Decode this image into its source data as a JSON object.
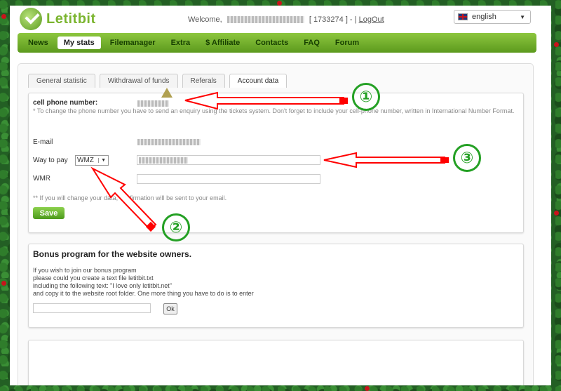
{
  "header": {
    "logo_text": "Letitbit",
    "welcome_prefix": "Welcome,",
    "account_id": "[ 1733274 ] -",
    "separator": "|",
    "logout": "LogOut"
  },
  "language": {
    "selected": "english"
  },
  "nav": {
    "items": [
      {
        "label": "News"
      },
      {
        "label": "My stats",
        "active": true
      },
      {
        "label": "Filemanager"
      },
      {
        "label": "Extra"
      },
      {
        "label": "$ Affiliate"
      },
      {
        "label": "Contacts"
      },
      {
        "label": "FAQ"
      },
      {
        "label": "Forum"
      }
    ]
  },
  "tabs": [
    {
      "label": "General statistic"
    },
    {
      "label": "Withdrawal of funds"
    },
    {
      "label": "Referals"
    },
    {
      "label": "Account data",
      "active": true
    }
  ],
  "account_form": {
    "phone_label": "cell phone number:",
    "phone_note": "* To change the phone number you have to send an enquiry using the tickets system. Don't forget to include your cell-phone number, written in International Number Format.",
    "email_label": "E-mail",
    "way_to_pay_label": "Way to pay",
    "way_to_pay_selected": "WMZ",
    "wmr_label": "WMR",
    "change_note": "** If you will change your data, confirmation will be sent to your email.",
    "save_label": "Save"
  },
  "bonus": {
    "title": "Bonus program for the website owners.",
    "line1": "If you wish to join our bonus program",
    "line2": "please could you create a text file letitbit.txt",
    "line3": "including the following text: \"I love only letitbit.net\"",
    "line4": "and copy it to the website root folder. One more thing you have to do is to enter",
    "ok_label": "Ok"
  },
  "annotations": {
    "one": "①",
    "two": "②",
    "three": "③",
    "color": "#ff0000",
    "circle_color": "#24a024"
  },
  "colors": {
    "brand_green": "#7bb52f",
    "nav_top": "#8dc63f",
    "nav_bottom": "#5c9a1d"
  }
}
